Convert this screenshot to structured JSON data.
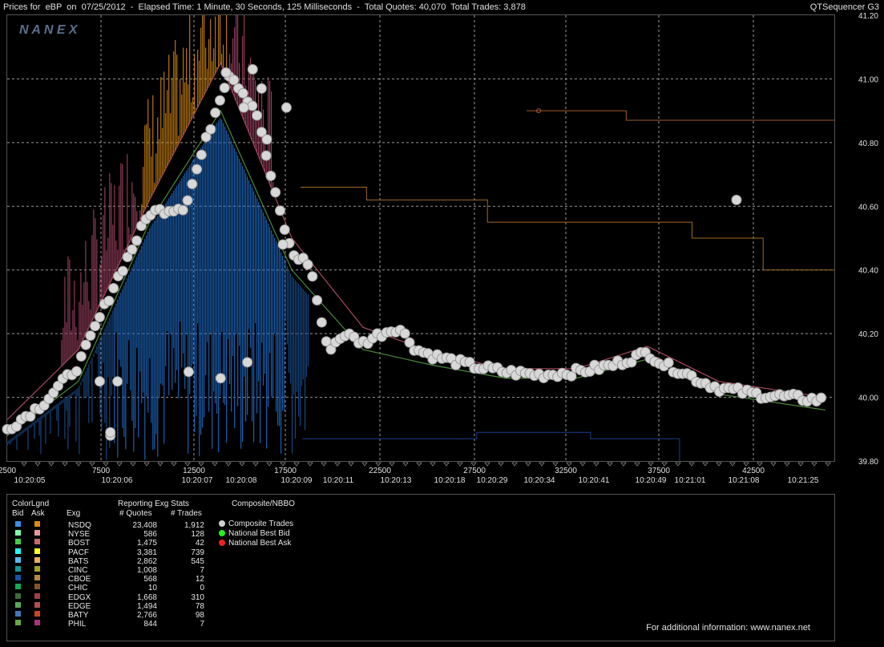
{
  "header": {
    "title": "Prices for  eBP  on  07/25/2012  -  Elapsed Time: 1 Minute, 30 Seconds, 125 Milliseconds  -  Total Quotes: 40,070  Total Trades: 3,878",
    "app": "QTSequencer G3"
  },
  "watermark": "N A N E X",
  "chart_data": {
    "type": "line",
    "title": "Prices for  eBP  on  07/25/2012",
    "ylim": [
      39.8,
      41.2
    ],
    "y_ticks": [
      "41.20",
      "41.00",
      "40.80",
      "40.60",
      "40.40",
      "40.20",
      "40.00",
      "39.80"
    ],
    "x_seq_ticks": [
      "2500",
      "7500",
      "12500",
      "17500",
      "22500",
      "27500",
      "32500",
      "37500",
      "42500"
    ],
    "x_time_labels": [
      "10:20:05",
      "10:20:06",
      "10:20:07",
      "10:20:08",
      "10:20:09",
      "10:20:11",
      "10:20:13",
      "10:20:18",
      "10:20:29",
      "10:20:34",
      "10:20:41",
      "10:20:49",
      "10:21:01",
      "10:21:08",
      "10:21:25"
    ],
    "grid": true,
    "series": [
      {
        "name": "Composite Trades",
        "x": [
          0,
          2000,
          4000,
          6000,
          8000,
          10000,
          12000,
          12500,
          14000,
          15000,
          16000,
          17000,
          18000,
          19000,
          20000,
          21000,
          22000,
          23000,
          24000,
          26000,
          28000,
          30000,
          32000,
          34000,
          36000,
          37000,
          38000,
          39000,
          40000,
          41000,
          42000,
          44000,
          46000
        ],
        "values": [
          39.9,
          39.98,
          40.1,
          40.35,
          40.58,
          40.6,
          40.95,
          41.02,
          40.9,
          40.65,
          40.45,
          40.42,
          40.15,
          40.2,
          40.17,
          40.2,
          40.22,
          40.15,
          40.13,
          40.1,
          40.08,
          40.07,
          40.08,
          40.1,
          40.14,
          40.1,
          40.08,
          40.05,
          40.03,
          40.02,
          40.01,
          40.0,
          39.99
        ]
      },
      {
        "name": "National Best Bid",
        "x": [
          0,
          4000,
          8000,
          12000,
          16000,
          20000,
          24000,
          28000,
          32000,
          36000,
          40000,
          46000
        ],
        "values": [
          39.88,
          40.05,
          40.55,
          40.9,
          40.4,
          40.15,
          40.1,
          40.06,
          40.06,
          40.12,
          40.01,
          39.96
        ]
      },
      {
        "name": "National Best Ask",
        "x": [
          0,
          4000,
          8000,
          12000,
          16000,
          20000,
          24000,
          28000,
          32000,
          36000,
          40000,
          46000
        ],
        "values": [
          39.93,
          40.15,
          40.62,
          41.05,
          40.5,
          40.22,
          40.14,
          40.09,
          40.09,
          40.16,
          40.05,
          40.0
        ]
      }
    ]
  },
  "legend": {
    "col_color": "ColorLgnd",
    "col_bid": "Bid",
    "col_ask": "Ask",
    "col_exg": "Exg",
    "stats_title": "Reporting Exg Stats",
    "col_quotes": "# Quotes",
    "col_trades": "# Trades",
    "comp_title": "Composite/NBBO",
    "rows": [
      {
        "exg": "NSDQ",
        "quotes": "23,408",
        "trades": "1,912",
        "bid": "#3a8ee8",
        "ask": "#e08a10"
      },
      {
        "exg": "NYSE",
        "quotes": "586",
        "trades": "128",
        "bid": "#7fffaa",
        "ask": "#e89a9a"
      },
      {
        "exg": "BOST",
        "quotes": "1,475",
        "trades": "42",
        "bid": "#44cc44",
        "ask": "#c86a6a"
      },
      {
        "exg": "PACF",
        "quotes": "3,381",
        "trades": "739",
        "bid": "#22ffff",
        "ask": "#ffff22"
      },
      {
        "exg": "BATS",
        "quotes": "2,862",
        "trades": "545",
        "bid": "#55bbee",
        "ask": "#e8b05a"
      },
      {
        "exg": "CINC",
        "quotes": "1,008",
        "trades": "7",
        "bid": "#119999",
        "ask": "#a8a020"
      },
      {
        "exg": "CBOE",
        "quotes": "568",
        "trades": "12",
        "bid": "#1155aa",
        "ask": "#b88a3a"
      },
      {
        "exg": "CHIC",
        "quotes": "10",
        "trades": "0",
        "bid": "#11aa55",
        "ask": "#885522"
      },
      {
        "exg": "EDGX",
        "quotes": "1,668",
        "trades": "310",
        "bid": "#3a6e3a",
        "ask": "#a04040"
      },
      {
        "exg": "EDGE",
        "quotes": "1,494",
        "trades": "78",
        "bid": "#55aa55",
        "ask": "#b05050"
      },
      {
        "exg": "BATY",
        "quotes": "2,766",
        "trades": "98",
        "bid": "#4477bb",
        "ask": "#cc4422"
      },
      {
        "exg": "PHIL",
        "quotes": "844",
        "trades": "7",
        "bid": "#66aa44",
        "ask": "#aa3377"
      }
    ],
    "composite": [
      {
        "label": "Composite Trades",
        "color": "#d0d0d0"
      },
      {
        "label": "National Best Bid",
        "color": "#22ee22"
      },
      {
        "label": "National Best Ask",
        "color": "#ee2222"
      }
    ]
  },
  "footer": {
    "info": "For additional information: www.nanex.net"
  }
}
